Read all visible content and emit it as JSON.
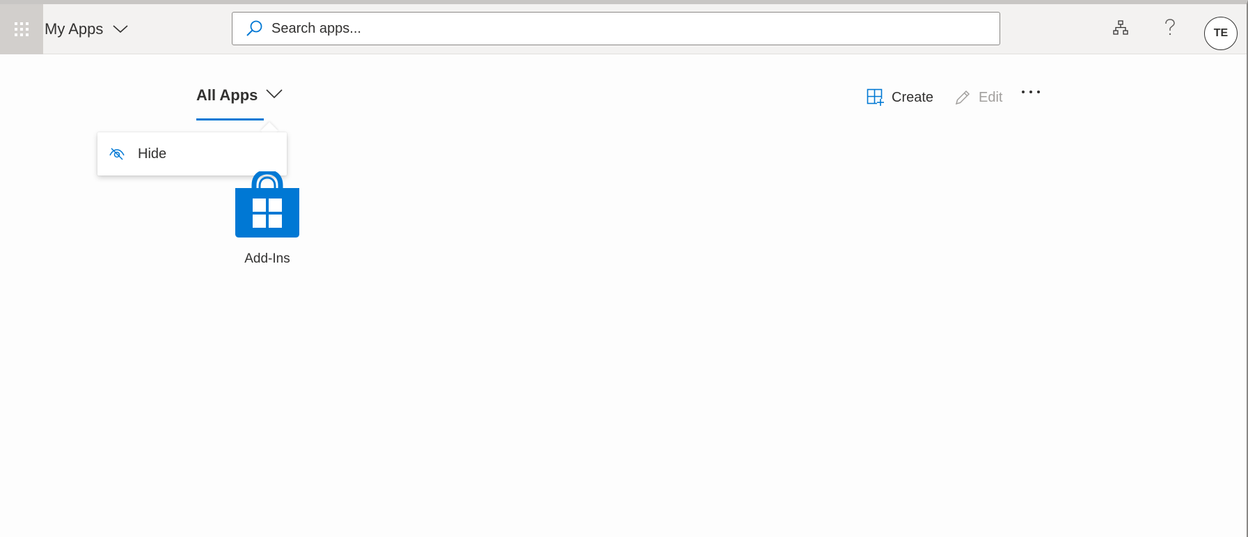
{
  "header": {
    "app_title": "My Apps",
    "search_placeholder": "Search apps...",
    "avatar_initials": "TE",
    "icons": [
      "waffle-icon",
      "chevron-down-icon",
      "search-icon",
      "org-chart-icon",
      "help-icon"
    ]
  },
  "main": {
    "pivot_label": "All Apps",
    "commands": {
      "create_label": "Create",
      "edit_label": "Edit"
    },
    "context_menu": {
      "items": [
        {
          "label": "Hide",
          "icon": "hide-icon"
        }
      ]
    },
    "apps": [
      {
        "label": "Add-Ins",
        "icon": "store-bag-icon"
      }
    ]
  },
  "colors": {
    "accent": "#0078d4",
    "header_bg": "#f3f2f1",
    "waffle_bg": "#d2cfcc",
    "text": "#323130",
    "disabled_text": "#a19f9d"
  }
}
